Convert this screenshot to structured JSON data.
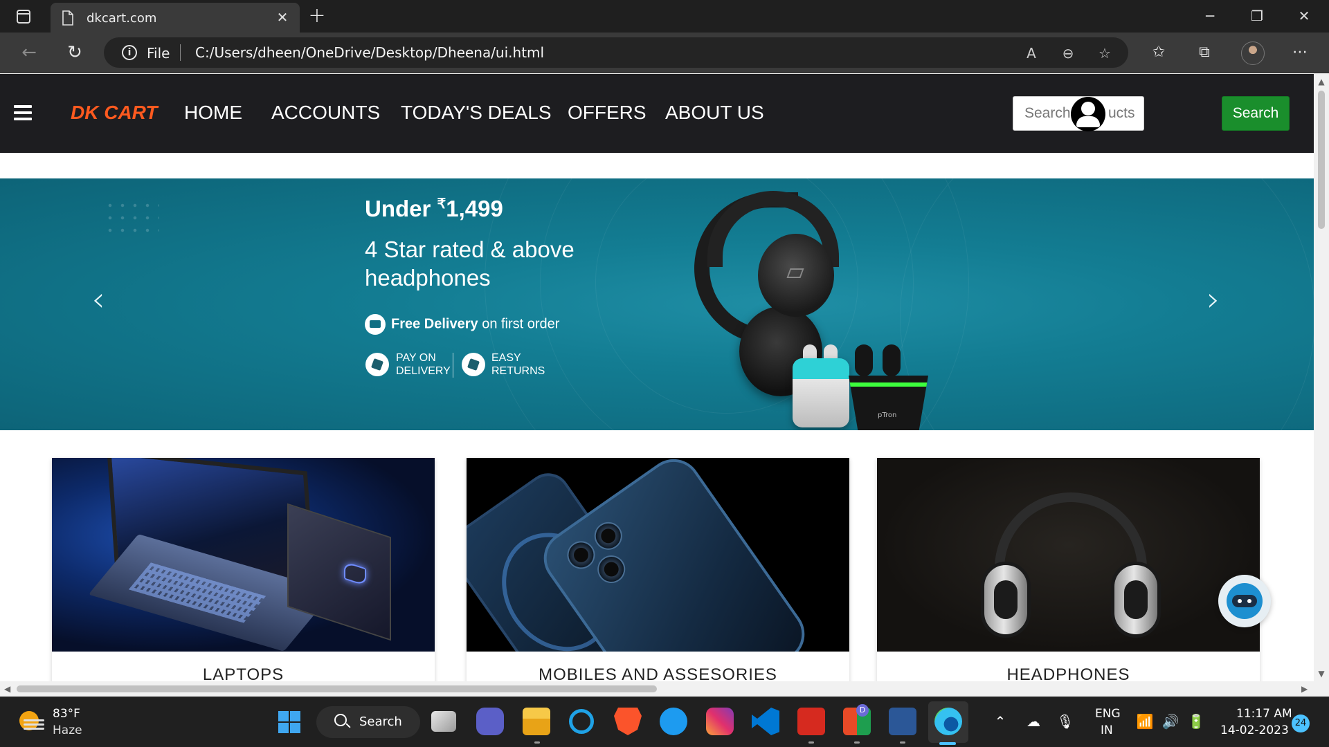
{
  "browser": {
    "tab_title": "dkcart.com",
    "scheme": "File",
    "url": "C:/Users/dheen/OneDrive/Desktop/Dheena/ui.html"
  },
  "site": {
    "brand": "DK CART",
    "nav": [
      "HOME",
      "ACCOUNTS",
      "TODAY'S DEALS",
      "OFFERS",
      "ABOUT US"
    ],
    "search_visible_left": "Search",
    "search_visible_right": "ucts",
    "search_button": "Search"
  },
  "hero": {
    "price_prefix": "Under ",
    "currency": "₹",
    "price": "1,499",
    "subtitle": "4 Star rated & above headphones",
    "delivery_bold": "Free Delivery",
    "delivery_rest": " on first order",
    "badge1_line1": "PAY ON",
    "badge1_line2": "DELIVERY",
    "badge2_line1": "EASY",
    "badge2_line2": "RETURNS",
    "product_brand": "pTron",
    "slide_count": 3,
    "active_slide": 1
  },
  "categories": [
    {
      "title": "LAPTOPS"
    },
    {
      "title": "MOBILES AND ASSESORIES"
    },
    {
      "title": "HEADPHONES"
    }
  ],
  "taskbar": {
    "weather_temp": "83°F",
    "weather_cond": "Haze",
    "search_label": "Search",
    "lang_line1": "ENG",
    "lang_line2": "IN",
    "time": "11:17 AM",
    "date": "14-02-2023",
    "notification_count": "24",
    "teams_badge": "D"
  },
  "colors": {
    "brand": "#ff5a1f",
    "search_button": "#1a8e2c",
    "navbar": "#1d1d20",
    "hero": "#137d93",
    "accent": "#4cc2ff"
  }
}
